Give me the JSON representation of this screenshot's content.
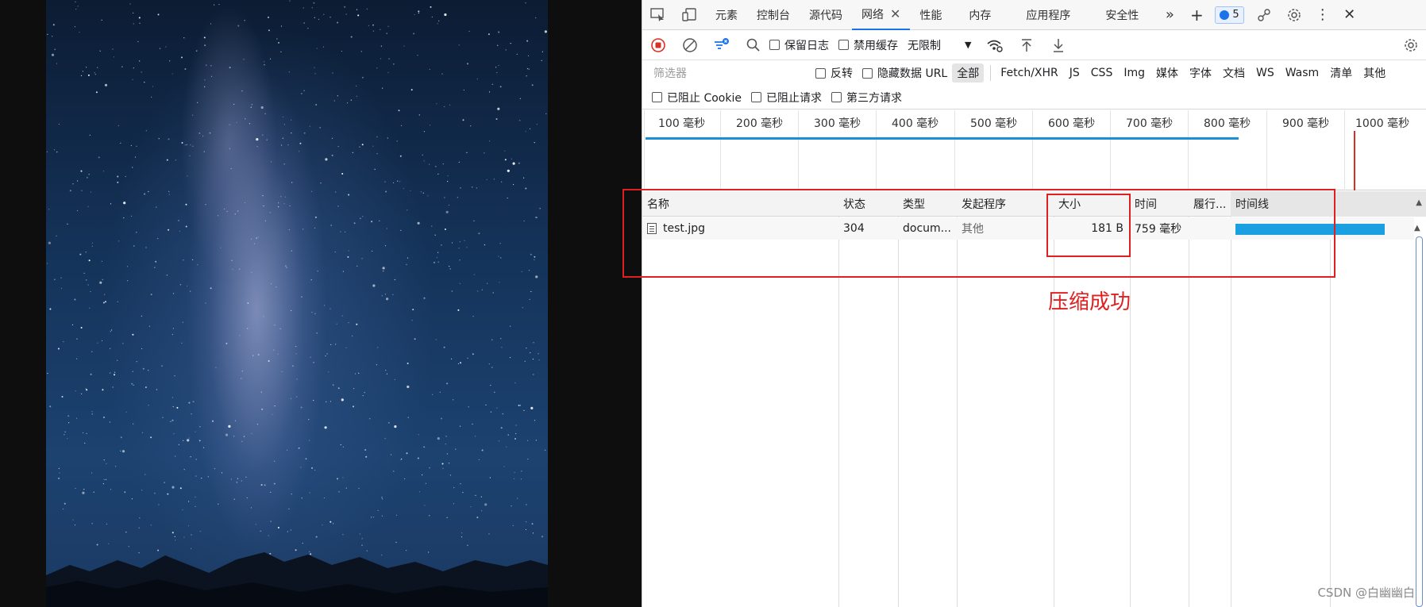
{
  "devtools": {
    "tabs": [
      "元素",
      "控制台",
      "源代码",
      "网络",
      "性能",
      "内存",
      "应用程序",
      "安全性"
    ],
    "active_tab": "网络",
    "issues_count": "5"
  },
  "toolbar": {
    "preserve_log": "保留日志",
    "disable_cache": "禁用缓存",
    "throttling": "无限制"
  },
  "filter": {
    "placeholder": "筛选器",
    "invert": "反转",
    "hide_data_urls": "隐藏数据 URL",
    "types": [
      "全部",
      "Fetch/XHR",
      "JS",
      "CSS",
      "Img",
      "媒体",
      "字体",
      "文档",
      "WS",
      "Wasm",
      "清单",
      "其他"
    ],
    "active_type": "全部",
    "blocked_cookies": "已阻止 Cookie",
    "blocked_requests": "已阻止请求",
    "third_party": "第三方请求"
  },
  "overview": {
    "ticks": [
      "100 毫秒",
      "200 毫秒",
      "300 毫秒",
      "400 毫秒",
      "500 毫秒",
      "600 毫秒",
      "700 毫秒",
      "800 毫秒",
      "900 毫秒",
      "1000 毫秒"
    ]
  },
  "table": {
    "columns": [
      "名称",
      "状态",
      "类型",
      "发起程序",
      "大小",
      "时间",
      "履行...",
      "时间线"
    ],
    "rows": [
      {
        "name": "test.jpg",
        "status": "304",
        "type": "docum...",
        "initiator": "其他",
        "size": "181 B",
        "time": "759 毫秒",
        "fulfilled": ""
      }
    ]
  },
  "annotation": {
    "label": "压缩成功",
    "color": "#e02020"
  },
  "watermark": "CSDN @白幽幽白"
}
